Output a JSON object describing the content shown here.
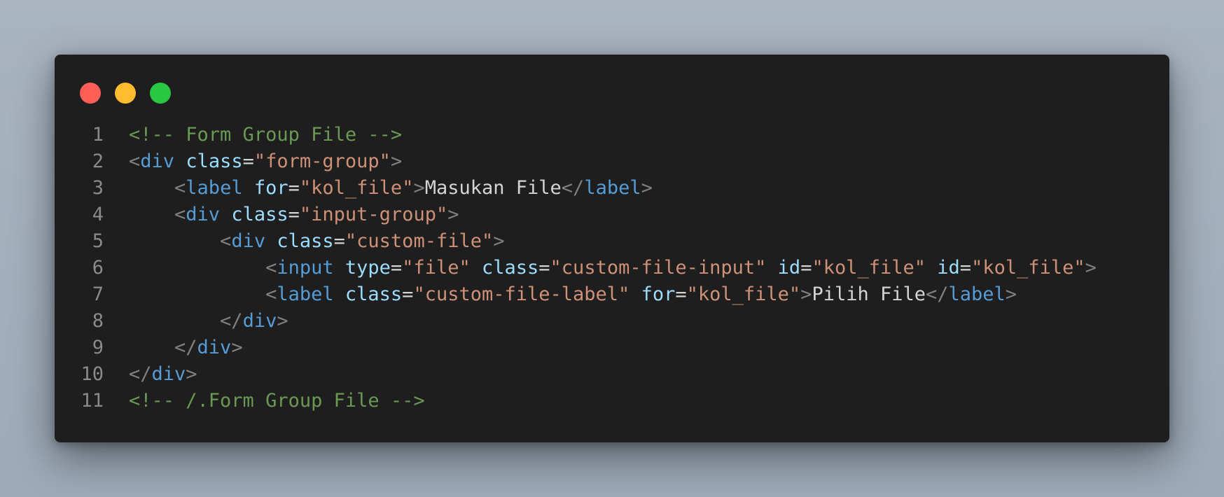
{
  "window": {
    "controls": [
      {
        "name": "close-button",
        "color": "#ff5f57"
      },
      {
        "name": "minimize-button",
        "color": "#febc2e"
      },
      {
        "name": "maximize-button",
        "color": "#28c840"
      }
    ]
  },
  "code": {
    "language": "html",
    "lines": [
      {
        "number": "1",
        "tokens": [
          {
            "t": "comment",
            "v": "<!-- Form Group File -->"
          }
        ]
      },
      {
        "number": "2",
        "tokens": [
          {
            "t": "punct",
            "v": "<"
          },
          {
            "t": "tag",
            "v": "div"
          },
          {
            "t": "text",
            "v": " "
          },
          {
            "t": "attr",
            "v": "class"
          },
          {
            "t": "eq",
            "v": "="
          },
          {
            "t": "str",
            "v": "\"form-group\""
          },
          {
            "t": "punct",
            "v": ">"
          }
        ]
      },
      {
        "number": "3",
        "tokens": [
          {
            "t": "text",
            "v": "    "
          },
          {
            "t": "punct",
            "v": "<"
          },
          {
            "t": "tag",
            "v": "label"
          },
          {
            "t": "text",
            "v": " "
          },
          {
            "t": "attr",
            "v": "for"
          },
          {
            "t": "eq",
            "v": "="
          },
          {
            "t": "str",
            "v": "\"kol_file\""
          },
          {
            "t": "punct",
            "v": ">"
          },
          {
            "t": "text",
            "v": "Masukan File"
          },
          {
            "t": "punct",
            "v": "</"
          },
          {
            "t": "tag",
            "v": "label"
          },
          {
            "t": "punct",
            "v": ">"
          }
        ]
      },
      {
        "number": "4",
        "tokens": [
          {
            "t": "text",
            "v": "    "
          },
          {
            "t": "punct",
            "v": "<"
          },
          {
            "t": "tag",
            "v": "div"
          },
          {
            "t": "text",
            "v": " "
          },
          {
            "t": "attr",
            "v": "class"
          },
          {
            "t": "eq",
            "v": "="
          },
          {
            "t": "str",
            "v": "\"input-group\""
          },
          {
            "t": "punct",
            "v": ">"
          }
        ]
      },
      {
        "number": "5",
        "tokens": [
          {
            "t": "text",
            "v": "        "
          },
          {
            "t": "punct",
            "v": "<"
          },
          {
            "t": "tag",
            "v": "div"
          },
          {
            "t": "text",
            "v": " "
          },
          {
            "t": "attr",
            "v": "class"
          },
          {
            "t": "eq",
            "v": "="
          },
          {
            "t": "str",
            "v": "\"custom-file\""
          },
          {
            "t": "punct",
            "v": ">"
          }
        ]
      },
      {
        "number": "6",
        "tokens": [
          {
            "t": "text",
            "v": "            "
          },
          {
            "t": "punct",
            "v": "<"
          },
          {
            "t": "tag",
            "v": "input"
          },
          {
            "t": "text",
            "v": " "
          },
          {
            "t": "attr",
            "v": "type"
          },
          {
            "t": "eq",
            "v": "="
          },
          {
            "t": "str",
            "v": "\"file\""
          },
          {
            "t": "text",
            "v": " "
          },
          {
            "t": "attr",
            "v": "class"
          },
          {
            "t": "eq",
            "v": "="
          },
          {
            "t": "str",
            "v": "\"custom-file-input\""
          },
          {
            "t": "text",
            "v": " "
          },
          {
            "t": "attr",
            "v": "id"
          },
          {
            "t": "eq",
            "v": "="
          },
          {
            "t": "str",
            "v": "\"kol_file\""
          },
          {
            "t": "text",
            "v": " "
          },
          {
            "t": "attr",
            "v": "id"
          },
          {
            "t": "eq",
            "v": "="
          },
          {
            "t": "str",
            "v": "\"kol_file\""
          },
          {
            "t": "punct",
            "v": ">"
          }
        ]
      },
      {
        "number": "7",
        "tokens": [
          {
            "t": "text",
            "v": "            "
          },
          {
            "t": "punct",
            "v": "<"
          },
          {
            "t": "tag",
            "v": "label"
          },
          {
            "t": "text",
            "v": " "
          },
          {
            "t": "attr",
            "v": "class"
          },
          {
            "t": "eq",
            "v": "="
          },
          {
            "t": "str",
            "v": "\"custom-file-label\""
          },
          {
            "t": "text",
            "v": " "
          },
          {
            "t": "attr",
            "v": "for"
          },
          {
            "t": "eq",
            "v": "="
          },
          {
            "t": "str",
            "v": "\"kol_file\""
          },
          {
            "t": "punct",
            "v": ">"
          },
          {
            "t": "text",
            "v": "Pilih File"
          },
          {
            "t": "punct",
            "v": "</"
          },
          {
            "t": "tag",
            "v": "label"
          },
          {
            "t": "punct",
            "v": ">"
          }
        ]
      },
      {
        "number": "8",
        "tokens": [
          {
            "t": "text",
            "v": "        "
          },
          {
            "t": "punct",
            "v": "</"
          },
          {
            "t": "tag",
            "v": "div"
          },
          {
            "t": "punct",
            "v": ">"
          }
        ]
      },
      {
        "number": "9",
        "tokens": [
          {
            "t": "text",
            "v": "    "
          },
          {
            "t": "punct",
            "v": "</"
          },
          {
            "t": "tag",
            "v": "div"
          },
          {
            "t": "punct",
            "v": ">"
          }
        ]
      },
      {
        "number": "10",
        "tokens": [
          {
            "t": "punct",
            "v": "</"
          },
          {
            "t": "tag",
            "v": "div"
          },
          {
            "t": "punct",
            "v": ">"
          }
        ]
      },
      {
        "number": "11",
        "tokens": [
          {
            "t": "comment",
            "v": "<!-- /.Form Group File -->"
          }
        ]
      }
    ]
  }
}
